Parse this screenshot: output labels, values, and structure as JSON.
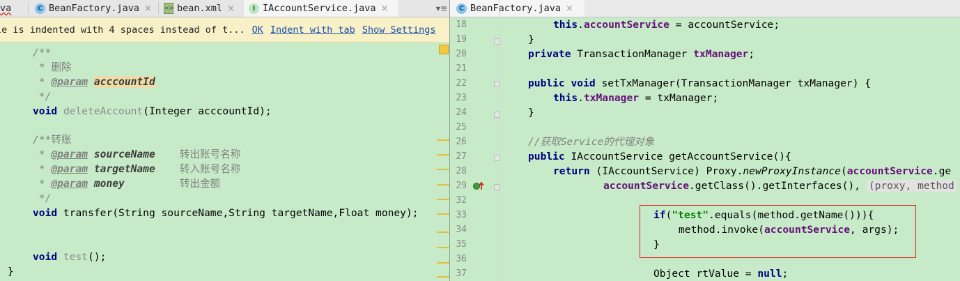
{
  "left_tabs": [
    {
      "label": "va"
    },
    {
      "label": "BeanFactory.java",
      "icon": "class-c-icon"
    },
    {
      "label": "bean.xml",
      "icon": "xml-file-icon"
    },
    {
      "label": "IAccountService.java",
      "icon": "interface-i-icon",
      "active": true
    }
  ],
  "tab_menu": "▾≡",
  "close_glyph": "×",
  "right_tab": {
    "label": "BeanFactory.java",
    "icon": "class-c-icon"
  },
  "notification": {
    "message": "le is indented with 4 spaces instead of t...",
    "ok": "OK",
    "indent_with_tab": "Indent with tab",
    "show_settings": "Show Settings"
  },
  "left_code": {
    "l1": "/**",
    "l2a": " * ",
    "l2b": "删除",
    "l3a": " * ",
    "l3b": "@param",
    "l3c": " ",
    "l3d": "acccountId",
    "l4": " */",
    "l5a": "void",
    "l5b": " ",
    "l5c": "deleteAccount",
    "l5d": "(Integer acccountId);",
    "l6a": "/**",
    "l6b": "转账",
    "l7a": " * ",
    "l7b": "@param",
    "l7c": " ",
    "l7d": "sourceName",
    "l7e": "    转出账号名称",
    "l8a": " * ",
    "l8b": "@param",
    "l8c": " ",
    "l8d": "targetName",
    "l8e": "    转入账号名称",
    "l9a": " * ",
    "l9b": "@param",
    "l9c": " ",
    "l9d": "money",
    "l9e": "         转出金额",
    "l10": " */",
    "l11a": "void",
    "l11b": " transfer(String sourceName,String targetName,Float money);",
    "l12a": "void",
    "l12b": " ",
    "l12c": "test",
    "l12d": "();",
    "l13": "}"
  },
  "right_lines": {
    "n18": "18",
    "n19": "19",
    "n20": "20",
    "n21": "21",
    "n22": "22",
    "n23": "23",
    "n24": "24",
    "n25": "25",
    "n26": "26",
    "n27": "27",
    "n28": "28",
    "n29": "29",
    "n32": "32",
    "n33": "33",
    "n34": "34",
    "n35": "35",
    "n36": "36",
    "n37": "37"
  },
  "right_code": {
    "r18a": "this",
    "r18b": ".",
    "r18c": "accountService",
    "r18d": " = accountService;",
    "r19": "}",
    "r20a": "private",
    "r20b": " TransactionManager ",
    "r20c": "txManager",
    "r20d": ";",
    "r22a": "public",
    "r22b": " ",
    "r22c": "void",
    "r22d": " setTxManager(TransactionManager txManager) {",
    "r23a": "this",
    "r23b": ".",
    "r23c": "txManager",
    "r23d": " = txManager;",
    "r24": "}",
    "r26a": "//获取",
    "r26b": "Service",
    "r26c": "的代理对象",
    "r27a": "public",
    "r27b": " IAccountService getAccountService(){",
    "r28a": "return",
    "r28b": " (IAccountService) Proxy.",
    "r28c": "newProxyInstance",
    "r28d": "(",
    "r28e": "accountService",
    "r28f": ".ge",
    "r29a": "accountService",
    "r29b": ".getClass().getInterfaces(), ",
    "r29c": "(proxy, method",
    "r33a": "if",
    "r33b": "(",
    "r33c": "\"test\"",
    "r33d": ".equals(method.getName())){",
    "r34a": "method.invoke(",
    "r34b": "accountService",
    "r34c": ", args);",
    "r35": "}",
    "r37a": "Object rtValue = ",
    "r37b": "null",
    "r37c": ";"
  }
}
